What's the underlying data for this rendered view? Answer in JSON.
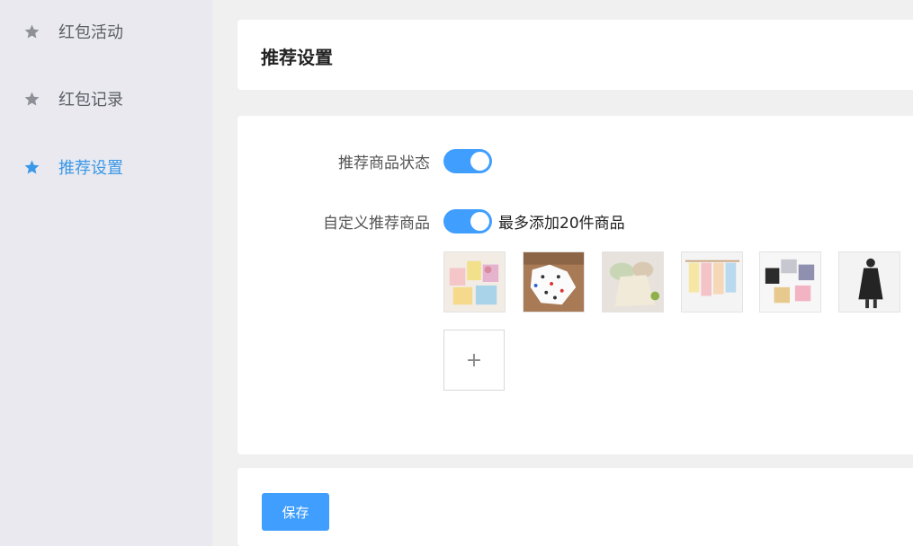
{
  "sidebar": {
    "items": [
      {
        "label": "红包活动",
        "icon": "star-icon",
        "active": false
      },
      {
        "label": "红包记录",
        "icon": "star-icon",
        "active": false
      },
      {
        "label": "推荐设置",
        "icon": "star-icon",
        "active": true
      }
    ]
  },
  "header": {
    "title": "推荐设置"
  },
  "form": {
    "status_label": "推荐商品状态",
    "status_on": true,
    "custom_label": "自定义推荐商品",
    "custom_on": true,
    "custom_hint": "最多添加20件商品",
    "thumbnails": [
      {
        "name": "product-image-1"
      },
      {
        "name": "product-image-2"
      },
      {
        "name": "product-image-3"
      },
      {
        "name": "product-image-4"
      },
      {
        "name": "product-image-5"
      },
      {
        "name": "product-image-6"
      }
    ],
    "add_symbol": "+"
  },
  "footer": {
    "save_label": "保存"
  },
  "colors": {
    "accent": "#409eff",
    "active_text": "#3a98e8",
    "sidebar_bg": "#e9e9ef",
    "page_bg": "#f0f0f1"
  }
}
